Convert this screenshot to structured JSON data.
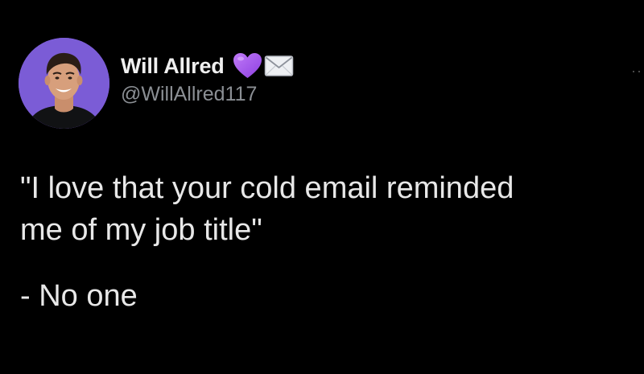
{
  "tweet": {
    "author": {
      "display_name": "Will Allred",
      "handle": "@WillAllred117",
      "avatar": "profile-photo",
      "badges": [
        "purple-heart-icon",
        "envelope-icon"
      ]
    },
    "body_lines": [
      "\"I love that your cold email reminded",
      "me of my job title\""
    ],
    "signature": "- No one",
    "more_icon": "more-dots-icon"
  },
  "colors": {
    "background": "#000000",
    "text": "#e8e8e8",
    "handle": "#8b8f94",
    "avatar_bg": "#7b5cd6",
    "heart": "#a95ef0"
  }
}
